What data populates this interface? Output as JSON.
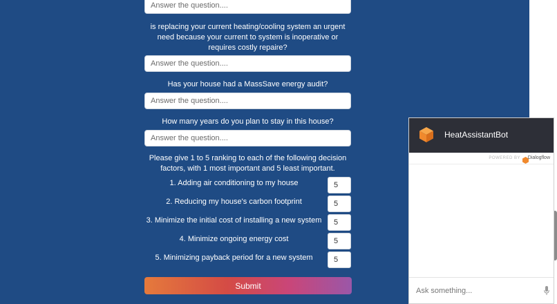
{
  "form": {
    "answer_placeholder": "Answer the question....",
    "questions": {
      "urgent": "is replacing your current heating/cooling system an urgent need because your current to system is inoperative or requires costly repaire?",
      "audit": "Has your house had a MassSave energy audit?",
      "years": "How many years do you plan to stay in this house?",
      "ranking": "Please give 1 to 5 ranking to each of the following decision factors, with 1 most important and 5 least important."
    },
    "factors": [
      {
        "label": "1. Adding air conditioning to my house",
        "value": "5"
      },
      {
        "label": "2. Reducing my house's carbon footprint",
        "value": "5"
      },
      {
        "label": "3. Minimize the initial cost of installing a new system",
        "value": "5"
      },
      {
        "label": "4. Minimize ongoing energy cost",
        "value": "5"
      },
      {
        "label": "5. Minimizing payback period for a new system",
        "value": "5"
      }
    ],
    "submit_label": "Submit"
  },
  "chat": {
    "title": "HeatAssistantBot",
    "powered_by": "POWERED BY",
    "provider": "Dialogflow",
    "input_placeholder": "Ask something..."
  },
  "colors": {
    "form_background": "#1f4b84",
    "chat_header": "#2d2f37",
    "bot_logo": "#f0892d"
  }
}
